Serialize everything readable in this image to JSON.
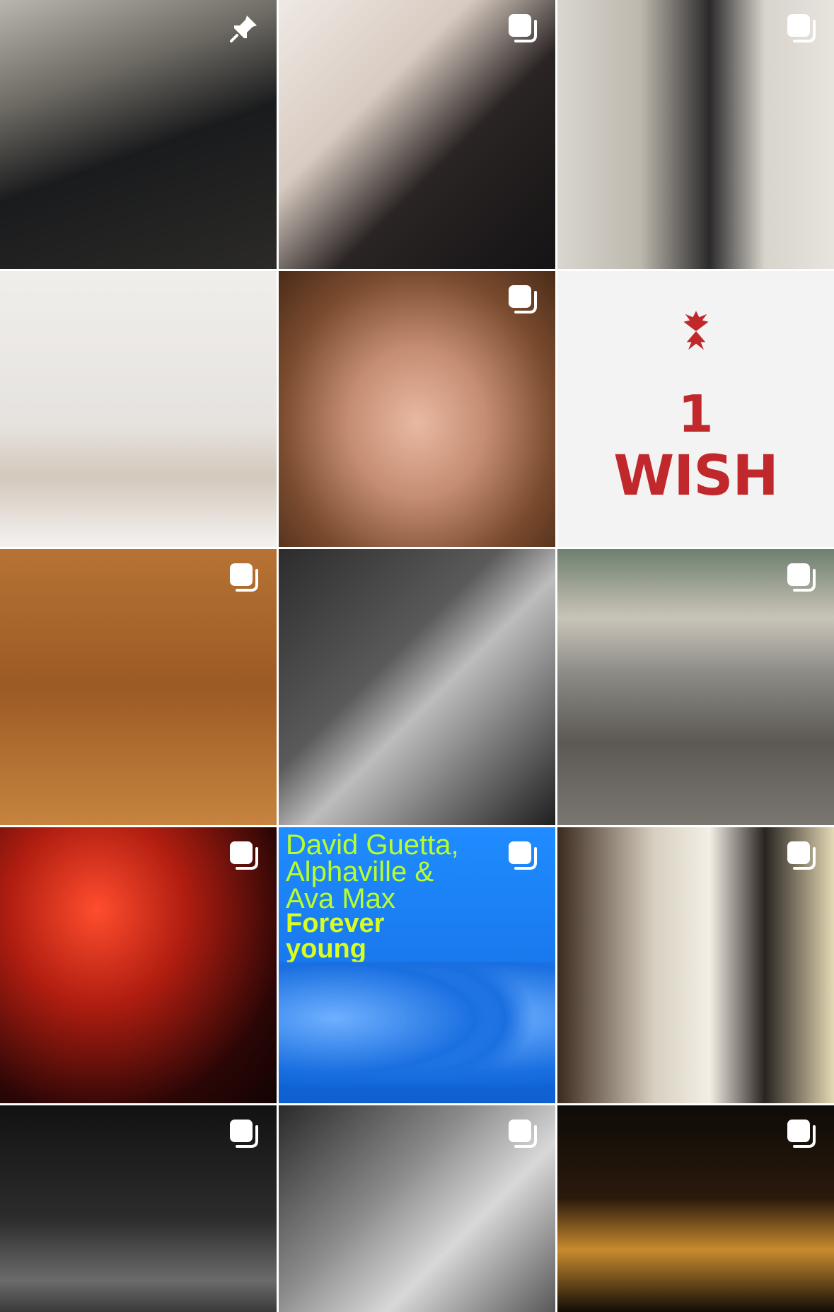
{
  "grid": {
    "tiles": [
      {
        "id": 0,
        "icon": "pin-icon"
      },
      {
        "id": 1,
        "icon": "carousel-icon"
      },
      {
        "id": 2,
        "icon": "carousel-icon"
      },
      {
        "id": 3,
        "icon": ""
      },
      {
        "id": 4,
        "icon": "carousel-icon"
      },
      {
        "id": 5,
        "icon": ""
      },
      {
        "id": 6,
        "icon": "carousel-icon"
      },
      {
        "id": 7,
        "icon": ""
      },
      {
        "id": 8,
        "icon": "carousel-icon"
      },
      {
        "id": 9,
        "icon": "carousel-icon"
      },
      {
        "id": 10,
        "icon": "carousel-icon"
      },
      {
        "id": 11,
        "icon": "carousel-icon"
      },
      {
        "id": 12,
        "icon": "carousel-icon"
      },
      {
        "id": 13,
        "icon": "carousel-icon"
      },
      {
        "id": 14,
        "icon": "carousel-icon"
      }
    ]
  },
  "tile5": {
    "number": "1",
    "word": "WISH"
  },
  "tile10": {
    "artists": "David Guetta, Alphaville & Ava Max",
    "artists_line1": "David Guetta,",
    "artists_line2": "Alphaville &",
    "artists_line3": "Ava Max",
    "title_line1": "Forever",
    "title_line2": "young"
  },
  "colors": {
    "wish_red": "#c0282b",
    "cover_blue": "#1775ea",
    "cover_yellow": "#d8ff1f"
  }
}
